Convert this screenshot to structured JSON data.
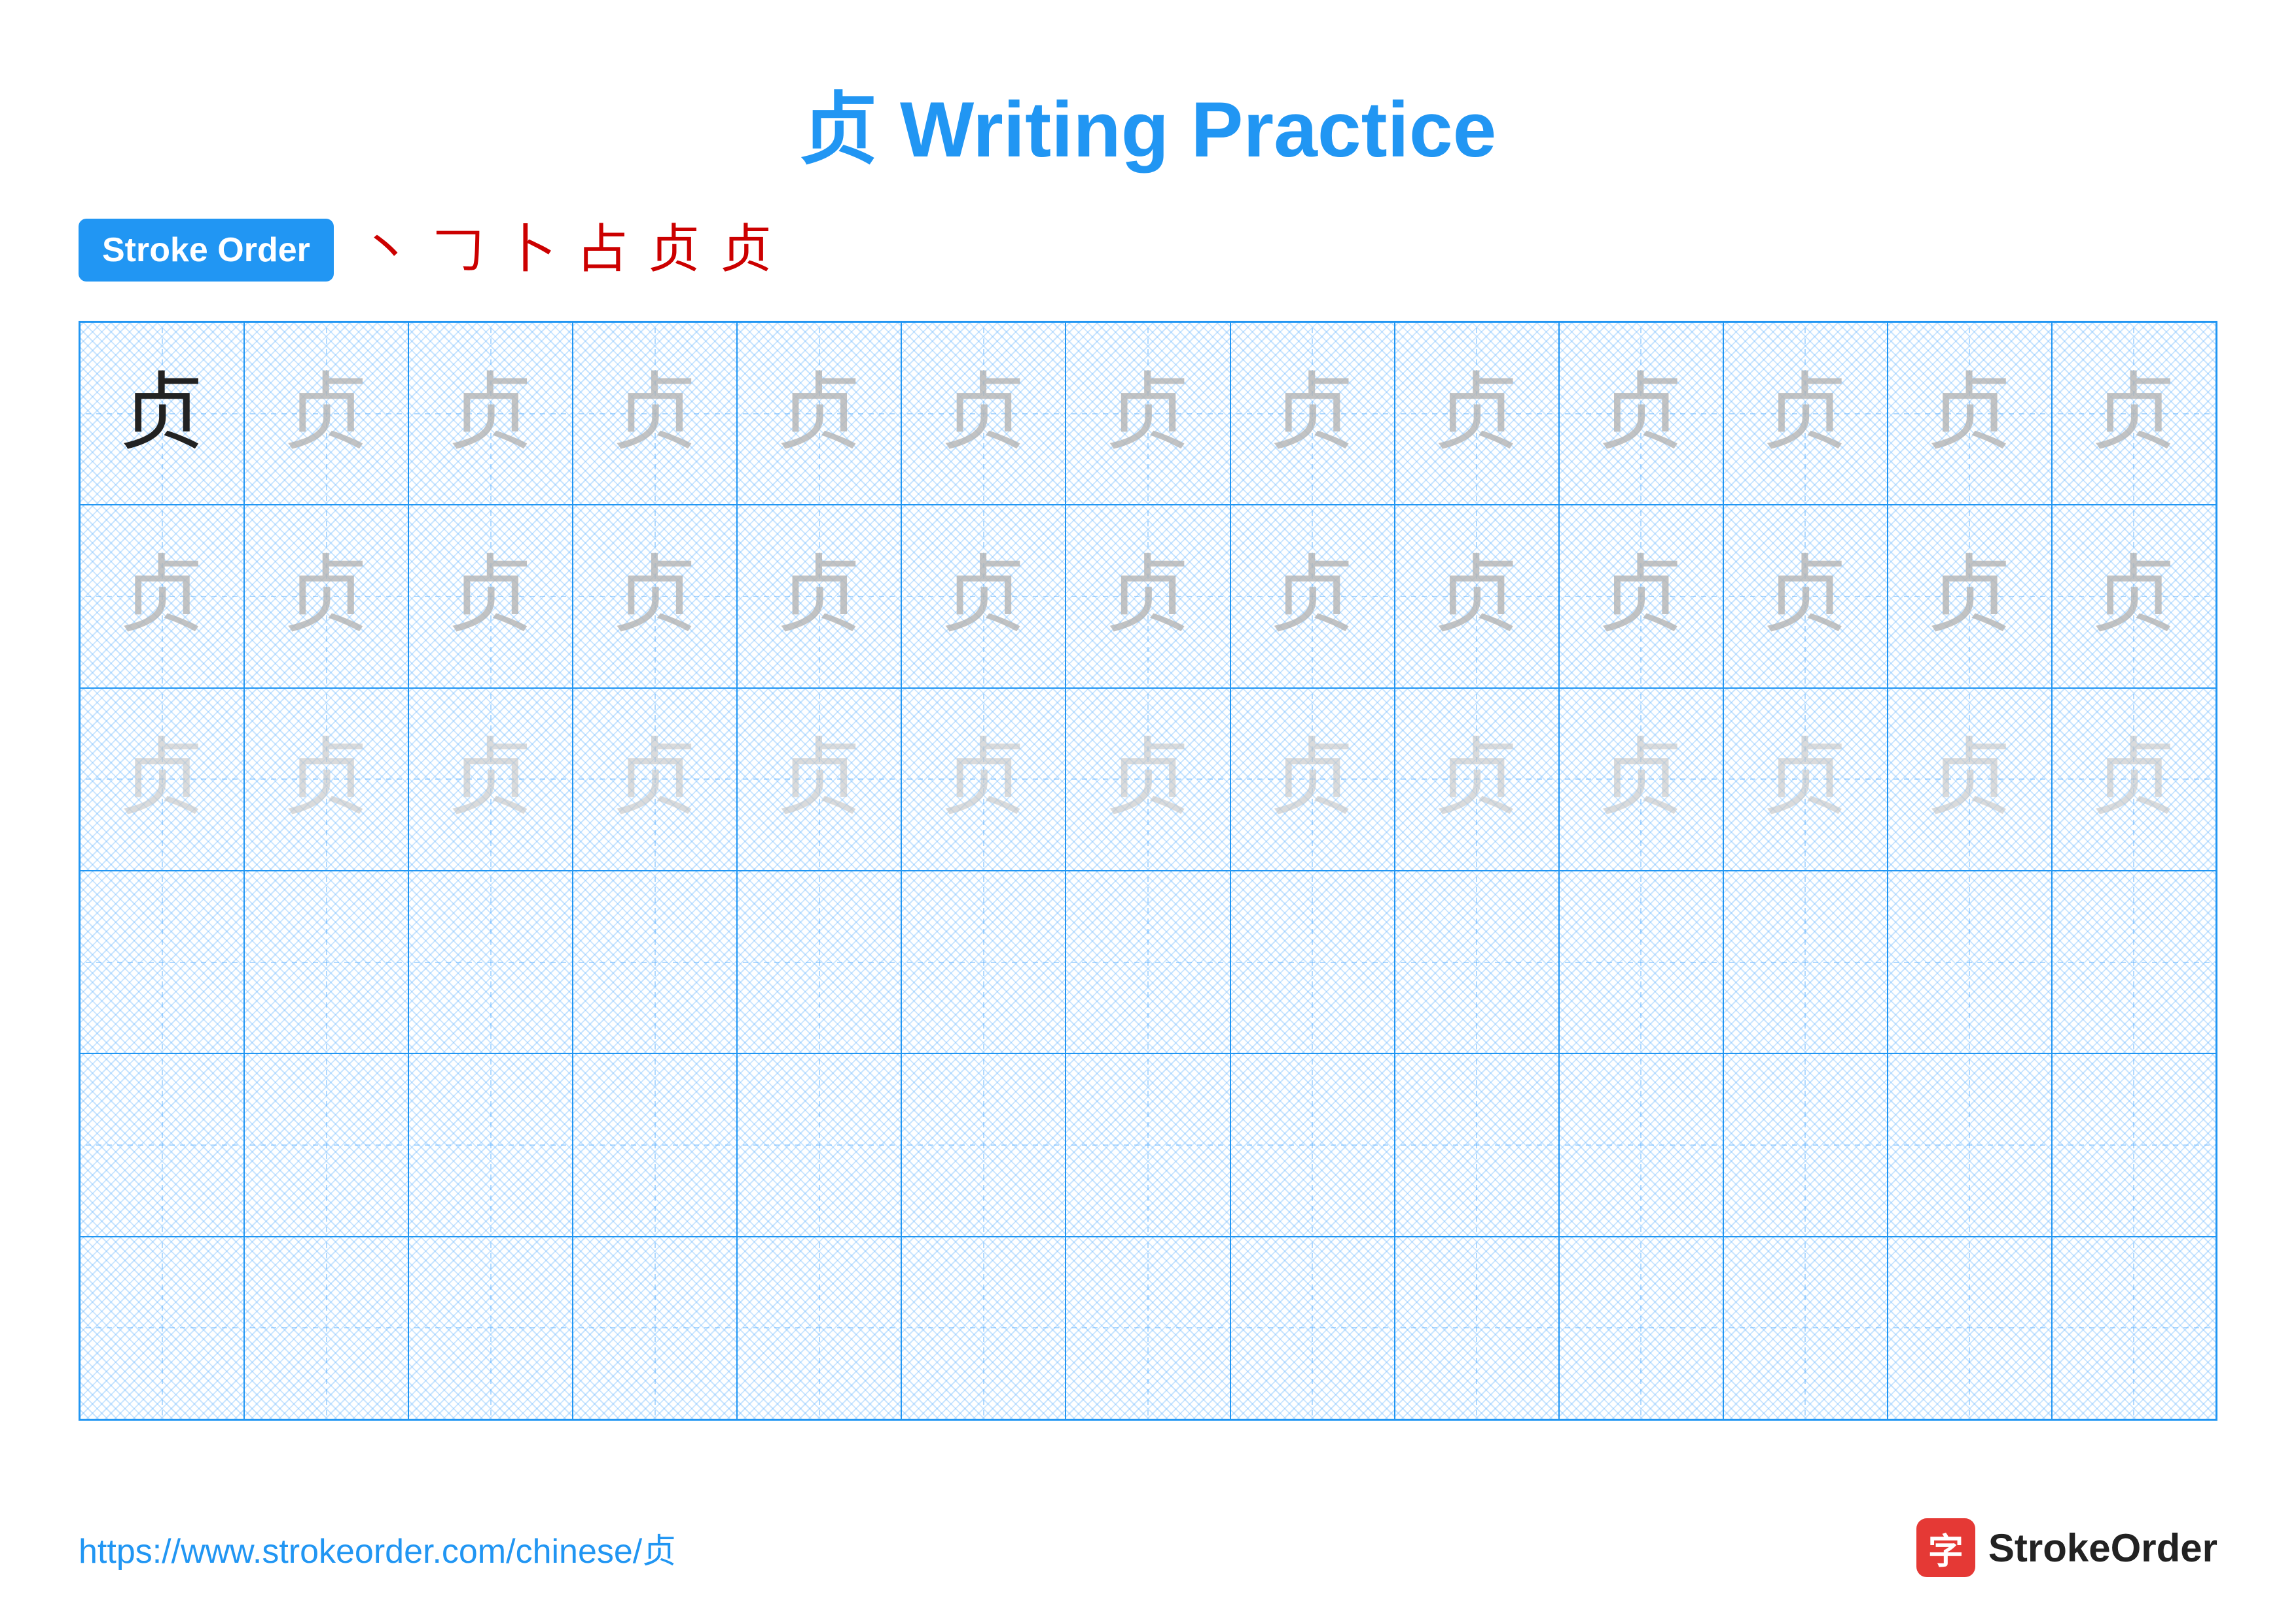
{
  "title": "贞 Writing Practice",
  "stroke_order": {
    "label": "Stroke Order",
    "strokes": [
      "丶",
      "𠃌",
      "卜",
      "占",
      "贞",
      "贞"
    ]
  },
  "character": "贞",
  "grid": {
    "rows": 6,
    "cols": 13,
    "cells": [
      {
        "row": 0,
        "col": 0,
        "style": "dark"
      },
      {
        "row": 0,
        "cols": "1-12",
        "style": "light1"
      },
      {
        "row": 1,
        "cols": "0-12",
        "style": "light1"
      },
      {
        "row": 2,
        "cols": "0-12",
        "style": "light2"
      },
      {
        "row": 3,
        "cols": "0-12",
        "style": "empty"
      },
      {
        "row": 4,
        "cols": "0-12",
        "style": "empty"
      },
      {
        "row": 5,
        "cols": "0-12",
        "style": "empty"
      }
    ]
  },
  "footer": {
    "url": "https://www.strokeorder.com/chinese/贞",
    "brand": "StrokeOrder",
    "logo_char": "字"
  },
  "colors": {
    "blue": "#2196F3",
    "red": "#cc0000",
    "dark_char": "#222222",
    "light_char_1": "rgba(180,180,180,0.8)",
    "light_char_2": "rgba(200,200,200,0.65)",
    "brand_red": "#e53935"
  }
}
